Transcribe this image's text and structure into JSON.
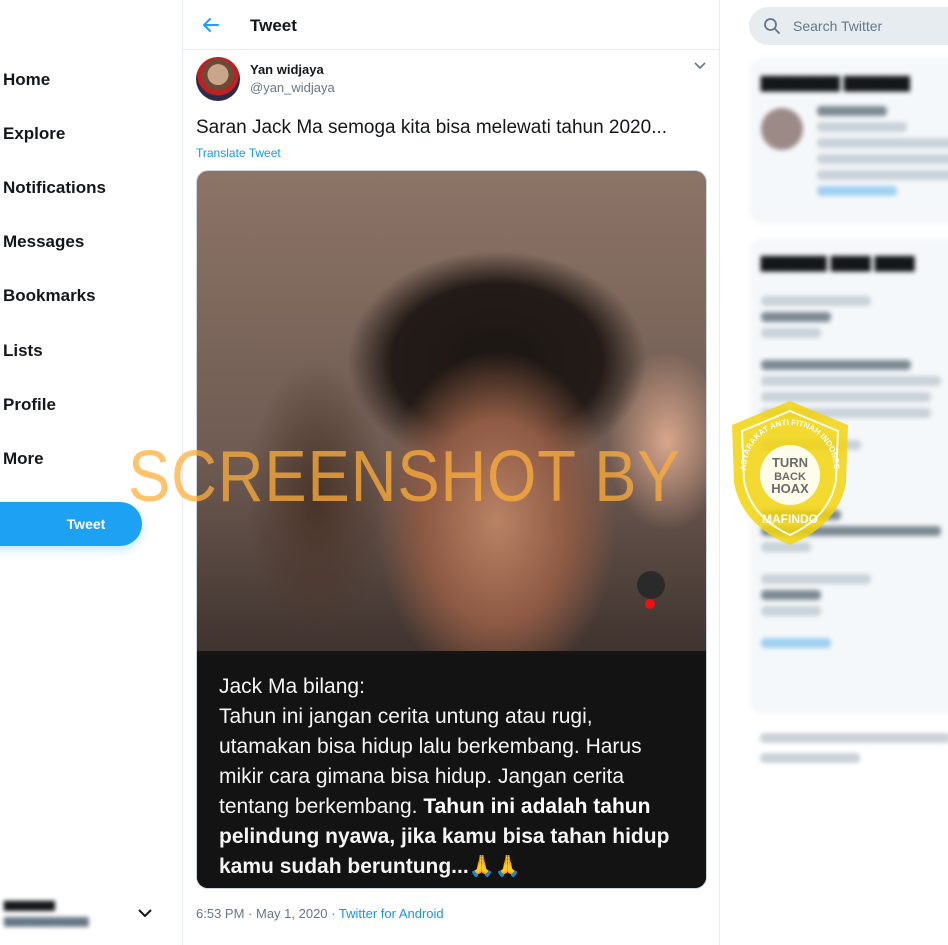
{
  "nav": {
    "items": [
      {
        "label": "Home"
      },
      {
        "label": "Explore"
      },
      {
        "label": "Notifications"
      },
      {
        "label": "Messages"
      },
      {
        "label": "Bookmarks"
      },
      {
        "label": "Lists"
      },
      {
        "label": "Profile"
      },
      {
        "label": "More"
      }
    ],
    "tweet_button": "Tweet"
  },
  "header": {
    "title": "Tweet"
  },
  "tweet": {
    "author_name": "Yan widjaya",
    "author_handle": "@yan_widjaya",
    "text": "Saran Jack Ma semoga kita bisa melewati tahun 2020...",
    "translate_label": "Translate Tweet",
    "media_caption": {
      "line1": "Jack Ma bilang:",
      "line2": "Tahun ini jangan cerita untung atau rugi,",
      "line3": "utamakan bisa hidup lalu berkembang. Harus",
      "line4": "mikir cara gimana bisa hidup. Jangan cerita",
      "line5_normal": "tentang berkembang. ",
      "line5_bold": "Tahun ini adalah tahun",
      "line6": "pelindung nyawa, jika kamu bisa tahan hidup",
      "line7": "kamu sudah beruntung...🙏🙏"
    },
    "time": "6:53 PM",
    "separator": " · ",
    "date": "May 1, 2020",
    "source": "Twitter for Android"
  },
  "search": {
    "placeholder": "Search Twitter"
  },
  "watermark": {
    "text": "SCREENSHOT BY",
    "badge_top": "MASYARAKAT ANTI FITNAH INDONESIA",
    "badge_center": [
      "TURN",
      "BACK",
      "HOAX"
    ],
    "badge_bottom": "MAFINDO",
    "badge_color": "#f2d40c"
  },
  "colors": {
    "accent": "#1da1f2",
    "link": "#1b95e0",
    "muted": "#657786"
  }
}
